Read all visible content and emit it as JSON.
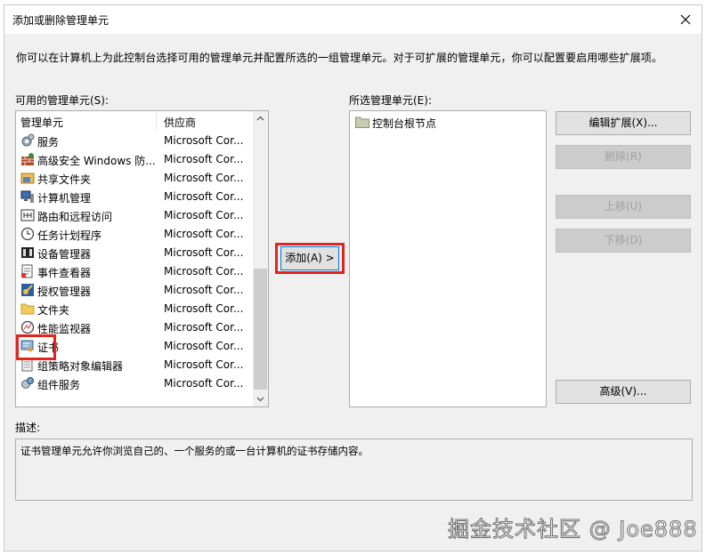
{
  "dialog": {
    "title": "添加或删除管理单元",
    "instructions": "你可以在计算机上为此控制台选择可用的管理单元并配置所选的一组管理单元。对于可扩展的管理单元，你可以配置要启用哪些扩展项。"
  },
  "available": {
    "label": "可用的管理单元(S):",
    "col_name": "管理单元",
    "col_vendor": "供应商",
    "items": [
      {
        "name": "服务",
        "vendor": "Microsoft Cor...",
        "icon": "services-gear-icon"
      },
      {
        "name": "高级安全 Windows 防...",
        "vendor": "Microsoft Cor...",
        "icon": "firewall-icon"
      },
      {
        "name": "共享文件夹",
        "vendor": "Microsoft Cor...",
        "icon": "shared-folder-icon"
      },
      {
        "name": "计算机管理",
        "vendor": "Microsoft Cor...",
        "icon": "computer-management-icon"
      },
      {
        "name": "路由和远程访问",
        "vendor": "Microsoft Cor...",
        "icon": "routing-icon"
      },
      {
        "name": "任务计划程序",
        "vendor": "Microsoft Cor...",
        "icon": "clock-icon"
      },
      {
        "name": "设备管理器",
        "vendor": "Microsoft Cor...",
        "icon": "device-manager-icon"
      },
      {
        "name": "事件查看器",
        "vendor": "Microsoft Cor...",
        "icon": "event-viewer-icon"
      },
      {
        "name": "授权管理器",
        "vendor": "Microsoft Cor...",
        "icon": "authorization-icon"
      },
      {
        "name": "文件夹",
        "vendor": "Microsoft Cor...",
        "icon": "folder-icon"
      },
      {
        "name": "性能监视器",
        "vendor": "Microsoft Cor...",
        "icon": "performance-icon"
      },
      {
        "name": "证书",
        "vendor": "Microsoft Cor...",
        "icon": "certificate-icon"
      },
      {
        "name": "组策略对象编辑器",
        "vendor": "Microsoft Cor...",
        "icon": "group-policy-icon"
      },
      {
        "name": "组件服务",
        "vendor": "Microsoft Cor...",
        "icon": "component-services-icon"
      }
    ]
  },
  "add_button": "添加(A) >",
  "selected": {
    "label": "所选管理单元(E):",
    "root": "控制台根节点"
  },
  "buttons": {
    "edit_extensions": "编辑扩展(X)...",
    "remove": "删除(R)",
    "move_up": "上移(U)",
    "move_down": "下移(D)",
    "advanced": "高级(V)..."
  },
  "description": {
    "label": "描述:",
    "text": "证书管理单元允许你浏览自己的、一个服务的或一台计算机的证书存储内容。"
  },
  "watermark": "掘金技术社区 @ Joe888",
  "colors": {
    "highlight": "#e3231c",
    "accent": "#0078d7"
  }
}
